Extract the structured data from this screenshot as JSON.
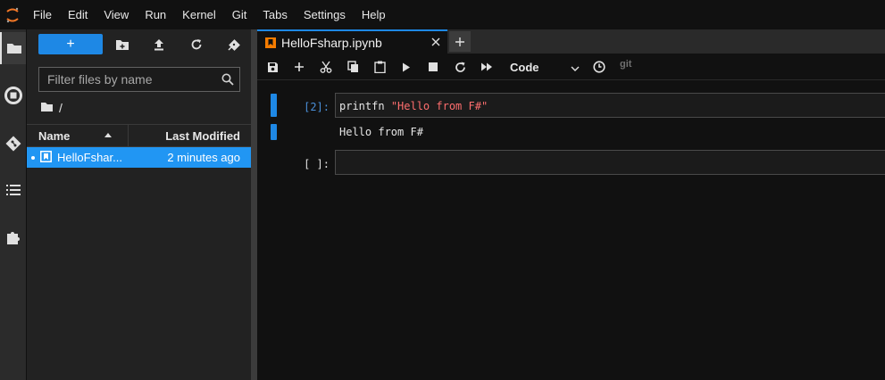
{
  "menubar": {
    "logo_icon": "jupyter-logo-icon",
    "items": [
      "File",
      "Edit",
      "View",
      "Run",
      "Kernel",
      "Git",
      "Tabs",
      "Settings",
      "Help"
    ]
  },
  "activity_bar": {
    "items": [
      "folder-icon",
      "running-icon",
      "git-icon",
      "toc-icon",
      "extension-icon"
    ]
  },
  "file_browser": {
    "new_label": "+",
    "toolbar_icons": [
      "new-folder-icon",
      "upload-icon",
      "refresh-icon",
      "git-clone-icon"
    ],
    "filter_placeholder": "Filter files by name",
    "breadcrumb": "/",
    "columns": {
      "name": "Name",
      "modified": "Last Modified"
    },
    "files": [
      {
        "name": "HelloFsharp.ipynb",
        "display_name": "HelloFshar...",
        "modified": "2 minutes ago",
        "icon": "notebook-icon"
      }
    ]
  },
  "tabs": [
    {
      "label": "HelloFsharp.ipynb",
      "icon": "notebook-icon"
    }
  ],
  "notebook_toolbar": {
    "icons": [
      "save-icon",
      "add-cell-icon",
      "cut-icon",
      "copy-icon",
      "paste-icon",
      "run-icon",
      "stop-icon",
      "restart-icon",
      "fast-forward-icon"
    ],
    "cell_type": "Code",
    "git_label": "git"
  },
  "cells": [
    {
      "prompt": "[2]:",
      "code_fn": "printfn",
      "code_str": "\"Hello from F#\"",
      "output": "Hello from F#"
    },
    {
      "prompt": "[ ]:",
      "code_fn": "",
      "code_str": ""
    }
  ],
  "colors": {
    "accent": "#1e88e5",
    "string": "#ff6e6e",
    "selection": "#2196f3"
  }
}
